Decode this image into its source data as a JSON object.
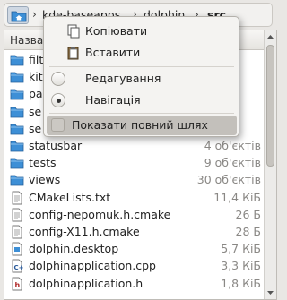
{
  "breadcrumb": {
    "segments": [
      "kde-baseapps",
      "dolphin",
      "src"
    ],
    "separator": "›"
  },
  "files": {
    "header_label": "Назва",
    "rows": [
      {
        "name": "filt",
        "size": "",
        "icon": "folder-icon"
      },
      {
        "name": "kit",
        "size": "",
        "icon": "folder-icon"
      },
      {
        "name": "pa",
        "size": "",
        "icon": "folder-icon"
      },
      {
        "name": "se",
        "size": "",
        "icon": "folder-icon"
      },
      {
        "name": "se",
        "size": "",
        "icon": "folder-icon"
      },
      {
        "name": "statusbar",
        "size": "4 об'єктів",
        "icon": "folder-icon"
      },
      {
        "name": "tests",
        "size": "9 об'єктів",
        "icon": "folder-icon"
      },
      {
        "name": "views",
        "size": "30 об'єктів",
        "icon": "folder-icon"
      },
      {
        "name": "CMakeLists.txt",
        "size": "11,4 КіБ",
        "icon": "text-file-icon"
      },
      {
        "name": "config-nepomuk.h.cmake",
        "size": "26 Б",
        "icon": "text-file-icon"
      },
      {
        "name": "config-X11.h.cmake",
        "size": "28 Б",
        "icon": "text-file-icon"
      },
      {
        "name": "dolphin.desktop",
        "size": "5,7 КіБ",
        "icon": "desktop-file-icon"
      },
      {
        "name": "dolphinapplication.cpp",
        "size": "3,3 КіБ",
        "icon": "cpp-file-icon"
      },
      {
        "name": "dolphinapplication.h",
        "size": "1,8 КіБ",
        "icon": "header-file-icon"
      }
    ]
  },
  "context_menu": {
    "copy_label": "Копіювати",
    "paste_label": "Вставити",
    "edit_label": "Редагування",
    "navigate_label": "Навігація",
    "show_full_path_label": "Показати повний шлях",
    "selected_mode": "navigate"
  },
  "colors": {
    "folder_blue": "#3d8fd6",
    "menu_highlight": "#c3c0bb"
  }
}
